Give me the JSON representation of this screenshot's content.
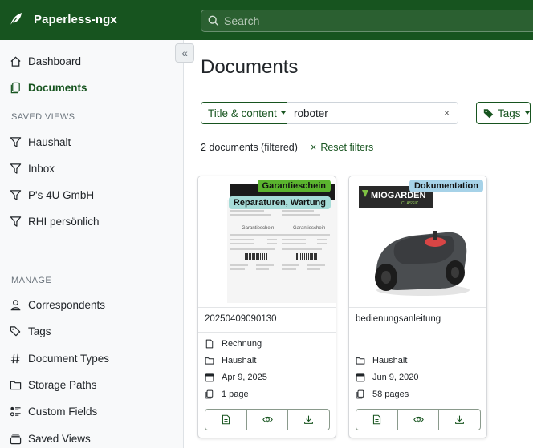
{
  "app": {
    "name": "Paperless-ngx"
  },
  "search": {
    "placeholder": "Search"
  },
  "sidebar": {
    "collapse_glyph": "«",
    "items": [
      {
        "label": "Dashboard",
        "icon": "house-icon"
      },
      {
        "label": "Documents",
        "icon": "files-icon",
        "active": true
      }
    ],
    "saved_views_title": "SAVED VIEWS",
    "saved_views": [
      {
        "label": "Haushalt",
        "icon": "funnel-icon"
      },
      {
        "label": "Inbox",
        "icon": "funnel-icon"
      },
      {
        "label": "P's 4U GmbH",
        "icon": "funnel-icon"
      },
      {
        "label": "RHI persönlich",
        "icon": "funnel-icon"
      }
    ],
    "manage_title": "MANAGE",
    "manage": [
      {
        "label": "Correspondents",
        "icon": "person-icon"
      },
      {
        "label": "Tags",
        "icon": "tags-icon"
      },
      {
        "label": "Document Types",
        "icon": "hash-icon"
      },
      {
        "label": "Storage Paths",
        "icon": "folder-icon"
      },
      {
        "label": "Custom Fields",
        "icon": "ui-radios-icon"
      },
      {
        "label": "Saved Views",
        "icon": "collection-icon"
      }
    ]
  },
  "main": {
    "title": "Documents",
    "filter": {
      "field_select": "Title & content",
      "query": "roboter",
      "clear_glyph": "×",
      "tags_button": "Tags"
    },
    "count_text": "2 documents (filtered)",
    "reset": {
      "glyph": "×",
      "label": "Reset filters"
    }
  },
  "colors": {
    "primary": "#17541f",
    "tag_green": "#5ab42e",
    "tag_cyan": "#a6dcd8",
    "tag_blue": "#a6d2e8"
  },
  "documents": [
    {
      "title": "20250409090130",
      "tags": [
        "Garantieschein",
        "Reparaturen, Wartung"
      ],
      "receipt_heading": "Garantieschein",
      "fields": {
        "type": "Rechnung",
        "path": "Haushalt",
        "date": "Apr 9, 2025",
        "pages": "1 page"
      }
    },
    {
      "title": "bedienungsanleitung",
      "tags": [
        "Dokumentation"
      ],
      "logo_text": "MIOGARDEN",
      "logo_sub": "CLASSIC",
      "fields": {
        "path": "Haushalt",
        "date": "Jun 9, 2020",
        "pages": "58 pages"
      }
    }
  ]
}
